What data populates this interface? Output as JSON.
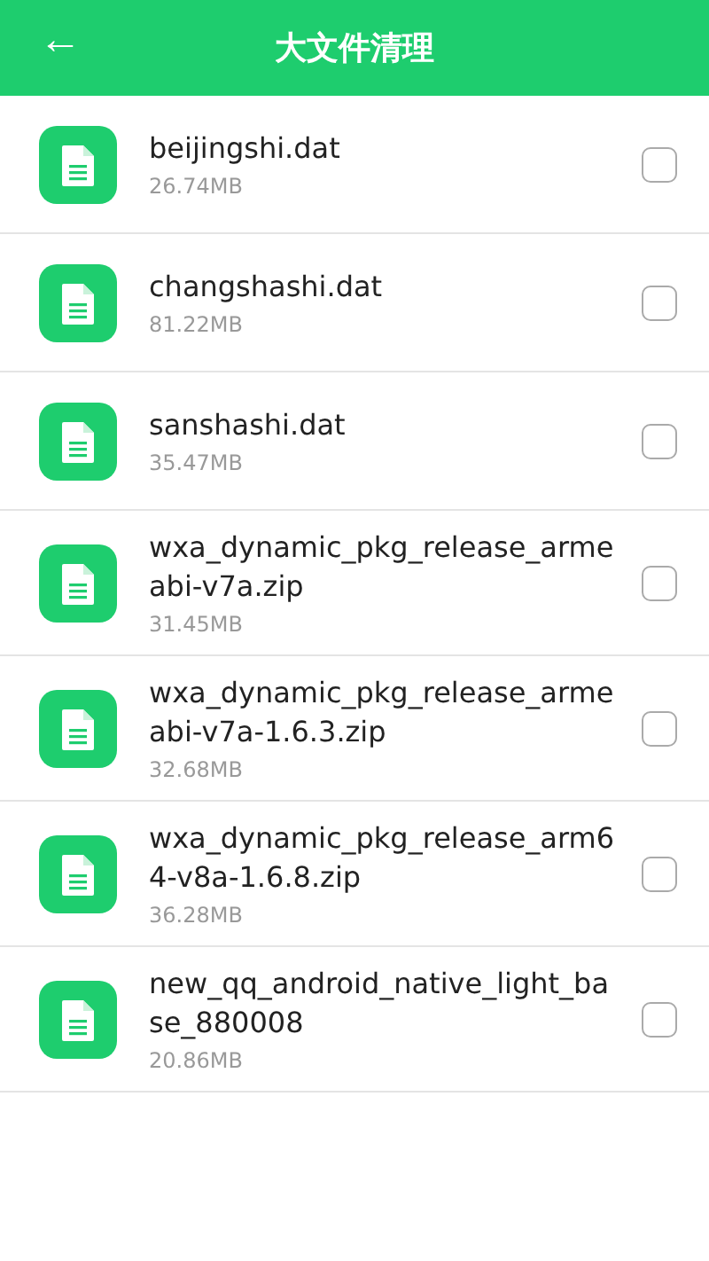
{
  "header": {
    "back": "←",
    "title": "大文件清理"
  },
  "files": [
    {
      "name": "beijingshi.dat",
      "size": "26.74MB",
      "checked": false
    },
    {
      "name": "changshashi.dat",
      "size": "81.22MB",
      "checked": false
    },
    {
      "name": "sanshashi.dat",
      "size": "35.47MB",
      "checked": false
    },
    {
      "name": "wxa_dynamic_pkg_release_armeabi-v7a.zip",
      "size": "31.45MB",
      "checked": false
    },
    {
      "name": "wxa_dynamic_pkg_release_armeabi-v7a-1.6.3.zip",
      "size": "32.68MB",
      "checked": false
    },
    {
      "name": "wxa_dynamic_pkg_release_arm64-v8a-1.6.8.zip",
      "size": "36.28MB",
      "checked": false
    },
    {
      "name": "new_qq_android_native_light_base_880008",
      "size": "20.86MB",
      "checked": false
    }
  ]
}
